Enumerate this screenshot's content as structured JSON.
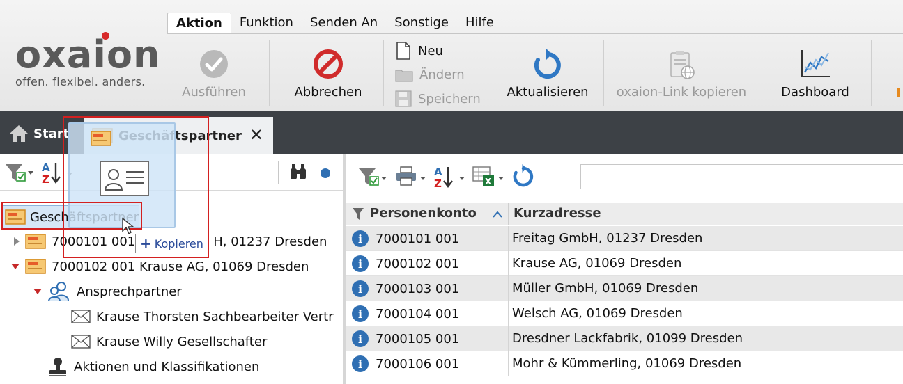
{
  "logo": {
    "word": "oxaion",
    "tagline": "offen. flexibel. anders."
  },
  "menu_tabs": [
    "Aktion",
    "Funktion",
    "Senden An",
    "Sonstige",
    "Hilfe"
  ],
  "ribbon": {
    "ausfuehren": "Ausführen",
    "abbrechen": "Abbrechen",
    "neu": "Neu",
    "aendern": "Ändern",
    "speichern": "Speichern",
    "aktualisieren": "Aktualisieren",
    "link_kopieren": "oxaion-Link kopieren",
    "dashboard": "Dashboard"
  },
  "tabs": {
    "start": "Start",
    "active": "Geschäftspartner"
  },
  "tree": {
    "root": "Geschäftspartner",
    "items": [
      {
        "label": "7000101 001 Freitag GmbH, 01237 Dresden",
        "visible": "7000101 001",
        "tail": "H, 01237 Dresden"
      },
      {
        "label": "7000102 001 Krause AG, 01069 Dresden"
      },
      {
        "label": "Ansprechpartner"
      },
      {
        "label": "Krause Thorsten Sachbearbeiter Vertr"
      },
      {
        "label": "Krause Willy Gesellschafter"
      },
      {
        "label": "Aktionen und Klassifikationen"
      }
    ]
  },
  "grid": {
    "col1": "Personenkonto",
    "col2": "Kurzadresse",
    "sort_icon": "^",
    "rows": [
      {
        "konto": "7000101 001",
        "adresse": "Freitag GmbH, 01237 Dresden"
      },
      {
        "konto": "7000102 001",
        "adresse": "Krause AG, 01069 Dresden"
      },
      {
        "konto": "7000103 001",
        "adresse": "Müller GmbH, 01069 Dresden"
      },
      {
        "konto": "7000104 001",
        "adresse": "Welsch AG, 01069 Dresden"
      },
      {
        "konto": "7000105 001",
        "adresse": "Dresdner Lackfabrik, 01099 Dresden"
      },
      {
        "konto": "7000106 001",
        "adresse": "Mohr & Kümmerling, 01069 Dresden"
      }
    ]
  },
  "drag": {
    "tooltip": "Kopieren"
  },
  "colors": {
    "accent_blue": "#2f6fb3",
    "red": "#d32020",
    "tabbar": "#3d4146"
  }
}
